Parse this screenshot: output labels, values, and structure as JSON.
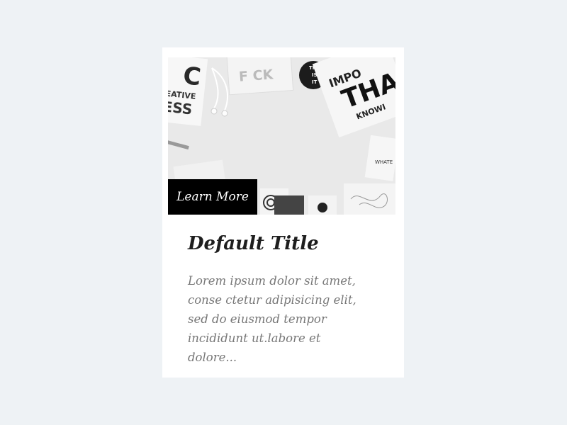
{
  "card": {
    "button_label": "Learn More",
    "title": "Default Title",
    "description": "Lorem ipsum dolor sit amet, conse ctetur adipisicing elit, sed do eiusmod tempor incididunt ut.labore et dolore..."
  },
  "image": {
    "poster_text": {
      "c": "C",
      "eative": "EATIVE",
      "ess": "ESS",
      "f": "F CK",
      "this": "THIS",
      "is": "IS",
      "it": "IT",
      "impo": "IMPO",
      "tha": "THA",
      "knowi": "KNOWI",
      "whate": "WHATE"
    }
  }
}
